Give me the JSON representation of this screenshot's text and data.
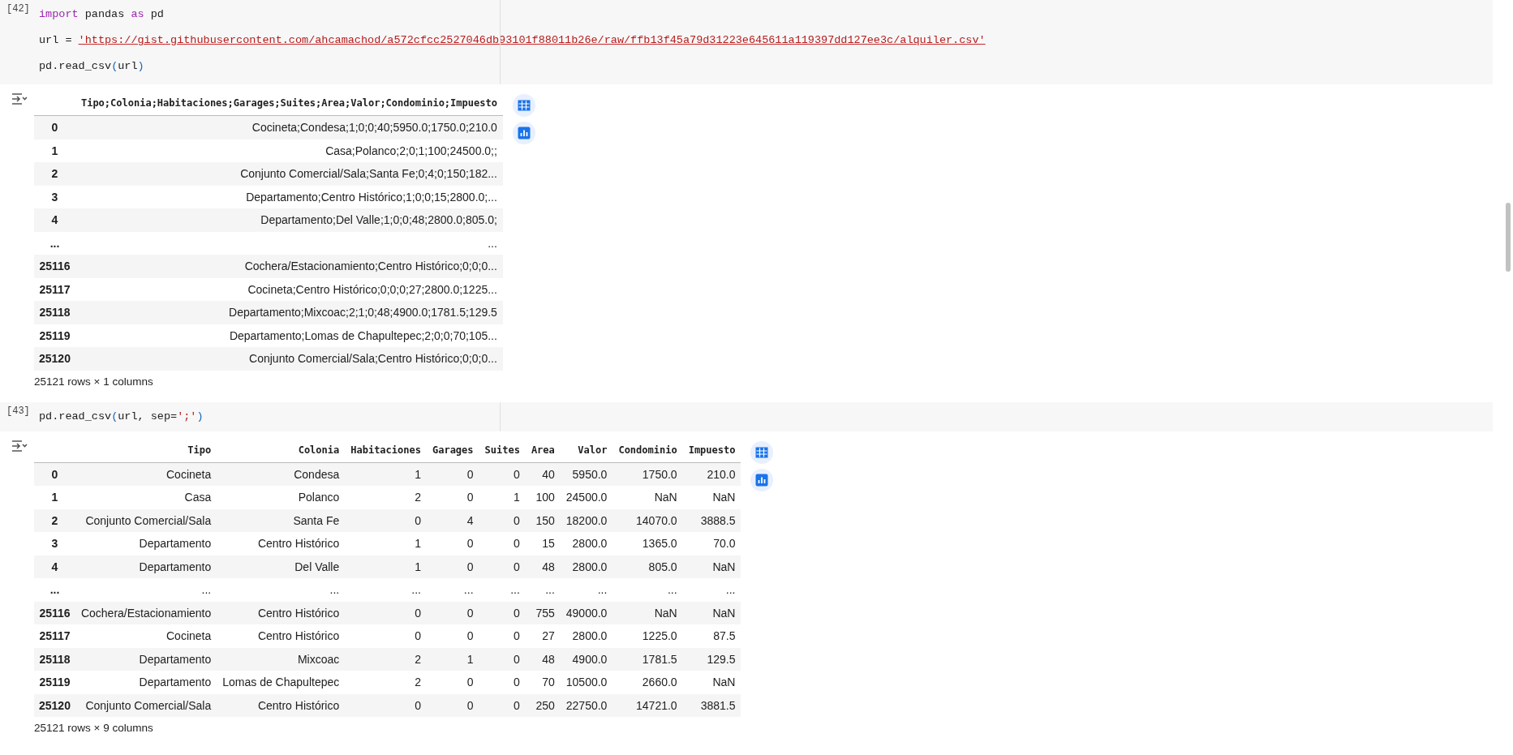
{
  "cells": [
    {
      "prompt": "[42]",
      "code_lines": [
        [
          {
            "text": "import",
            "kind": "keyword"
          },
          {
            "text": " pandas ",
            "kind": "plain"
          },
          {
            "text": "as",
            "kind": "keyword"
          },
          {
            "text": " pd",
            "kind": "plain"
          }
        ],
        [
          {
            "text": "url = ",
            "kind": "plain"
          },
          {
            "text": "'https://gist.githubusercontent.com/ahcamachod/a572cfcc2527046db93101f88011b26e/raw/ffb13f45a79d31223e645611a119397dd127ee3c/alquiler.csv'",
            "kind": "link"
          }
        ],
        [
          {
            "text": "pd.read_csv",
            "kind": "plain"
          },
          {
            "text": "(",
            "kind": "bracket"
          },
          {
            "text": "url",
            "kind": "plain"
          },
          {
            "text": ")",
            "kind": "bracket"
          }
        ]
      ],
      "output": {
        "columns": [
          "Tipo;Colonia;Habitaciones;Garages;Suites;Area;Valor;Condominio;Impuesto"
        ],
        "rows": [
          {
            "index": "0",
            "cells": [
              "Cocineta;Condesa;1;0;0;40;5950.0;1750.0;210.0"
            ]
          },
          {
            "index": "1",
            "cells": [
              "Casa;Polanco;2;0;1;100;24500.0;;"
            ]
          },
          {
            "index": "2",
            "cells": [
              "Conjunto Comercial/Sala;Santa Fe;0;4;0;150;182..."
            ]
          },
          {
            "index": "3",
            "cells": [
              "Departamento;Centro Histórico;1;0;0;15;2800.0;..."
            ]
          },
          {
            "index": "4",
            "cells": [
              "Departamento;Del Valle;1;0;0;48;2800.0;805.0;"
            ]
          },
          {
            "index": "...",
            "cells": [
              "..."
            ]
          },
          {
            "index": "25116",
            "cells": [
              "Cochera/Estacionamiento;Centro Histórico;0;0;0..."
            ]
          },
          {
            "index": "25117",
            "cells": [
              "Cocineta;Centro Histórico;0;0;0;27;2800.0;1225..."
            ]
          },
          {
            "index": "25118",
            "cells": [
              "Departamento;Mixcoac;2;1;0;48;4900.0;1781.5;129.5"
            ]
          },
          {
            "index": "25119",
            "cells": [
              "Departamento;Lomas de Chapultepec;2;0;0;70;105..."
            ]
          },
          {
            "index": "25120",
            "cells": [
              "Conjunto Comercial/Sala;Centro Histórico;0;0;0..."
            ]
          }
        ],
        "footer": "25121 rows × 1 columns"
      }
    },
    {
      "prompt": "[43]",
      "code_lines": [
        [
          {
            "text": "pd.read_csv",
            "kind": "plain"
          },
          {
            "text": "(",
            "kind": "bracket"
          },
          {
            "text": "url, sep=",
            "kind": "plain"
          },
          {
            "text": "';'",
            "kind": "string"
          },
          {
            "text": ")",
            "kind": "bracket"
          }
        ]
      ],
      "output": {
        "columns": [
          "Tipo",
          "Colonia",
          "Habitaciones",
          "Garages",
          "Suites",
          "Area",
          "Valor",
          "Condominio",
          "Impuesto"
        ],
        "rows": [
          {
            "index": "0",
            "cells": [
              "Cocineta",
              "Condesa",
              "1",
              "0",
              "0",
              "40",
              "5950.0",
              "1750.0",
              "210.0"
            ]
          },
          {
            "index": "1",
            "cells": [
              "Casa",
              "Polanco",
              "2",
              "0",
              "1",
              "100",
              "24500.0",
              "NaN",
              "NaN"
            ]
          },
          {
            "index": "2",
            "cells": [
              "Conjunto Comercial/Sala",
              "Santa Fe",
              "0",
              "4",
              "0",
              "150",
              "18200.0",
              "14070.0",
              "3888.5"
            ]
          },
          {
            "index": "3",
            "cells": [
              "Departamento",
              "Centro Histórico",
              "1",
              "0",
              "0",
              "15",
              "2800.0",
              "1365.0",
              "70.0"
            ]
          },
          {
            "index": "4",
            "cells": [
              "Departamento",
              "Del Valle",
              "1",
              "0",
              "0",
              "48",
              "2800.0",
              "805.0",
              "NaN"
            ]
          },
          {
            "index": "...",
            "cells": [
              "...",
              "...",
              "...",
              "...",
              "...",
              "...",
              "...",
              "...",
              "..."
            ]
          },
          {
            "index": "25116",
            "cells": [
              "Cochera/Estacionamiento",
              "Centro Histórico",
              "0",
              "0",
              "0",
              "755",
              "49000.0",
              "NaN",
              "NaN"
            ]
          },
          {
            "index": "25117",
            "cells": [
              "Cocineta",
              "Centro Histórico",
              "0",
              "0",
              "0",
              "27",
              "2800.0",
              "1225.0",
              "87.5"
            ]
          },
          {
            "index": "25118",
            "cells": [
              "Departamento",
              "Mixcoac",
              "2",
              "1",
              "0",
              "48",
              "4900.0",
              "1781.5",
              "129.5"
            ]
          },
          {
            "index": "25119",
            "cells": [
              "Departamento",
              "Lomas de Chapultepec",
              "2",
              "0",
              "0",
              "70",
              "10500.0",
              "2660.0",
              "NaN"
            ]
          },
          {
            "index": "25120",
            "cells": [
              "Conjunto Comercial/Sala",
              "Centro Histórico",
              "0",
              "0",
              "0",
              "250",
              "22750.0",
              "14721.0",
              "3881.5"
            ]
          }
        ],
        "footer": "25121 rows × 9 columns"
      }
    }
  ]
}
